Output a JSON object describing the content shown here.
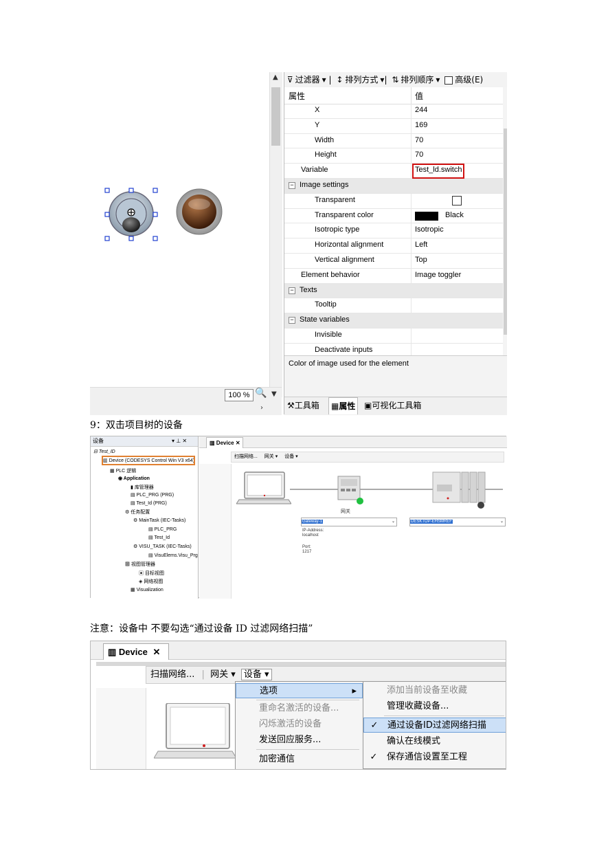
{
  "shot1": {
    "zoom": "100 %",
    "toolbar": {
      "filter": "过滤器",
      "sort_by": "排列方式",
      "sort_order": "排列顺序",
      "advanced": "高级(E)"
    },
    "header": {
      "property": "属性",
      "value": "值"
    },
    "rows": [
      {
        "key": "X",
        "value": "244"
      },
      {
        "key": "Y",
        "value": "169"
      },
      {
        "key": "Width",
        "value": "70"
      },
      {
        "key": "Height",
        "value": "70"
      },
      {
        "key": "Variable",
        "value": "Test_ld.switch"
      },
      {
        "key": "Image settings",
        "value": ""
      },
      {
        "key": "Transparent",
        "value": ""
      },
      {
        "key": "Transparent color",
        "value": "Black"
      },
      {
        "key": "Isotropic type",
        "value": "Isotropic"
      },
      {
        "key": "Horizontal alignment",
        "value": "Left"
      },
      {
        "key": "Vertical alignment",
        "value": "Top"
      },
      {
        "key": "Element behavior",
        "value": "Image toggler"
      },
      {
        "key": "Texts",
        "value": ""
      },
      {
        "key": "Tooltip",
        "value": ""
      },
      {
        "key": "State variables",
        "value": ""
      },
      {
        "key": "Invisible",
        "value": ""
      },
      {
        "key": "Deactivate inputs",
        "value": ""
      }
    ],
    "description": "Color of image used for the element",
    "tabs": {
      "toolbox": "工具箱",
      "properties": "属性",
      "visu_toolbox": "可视化工具箱"
    },
    "colors": {
      "highlight": "#d01010"
    }
  },
  "caption9": "9：双击项目树的设备",
  "shot2": {
    "tree_title": "设备",
    "tree": [
      "Test_ID",
      "Device (CODESYS Control Win V3 x64)",
      "PLC 逻辑",
      "Application",
      "库管理器",
      "PLC_PRG (PRG)",
      "Test_Id (PRG)",
      "任务配置",
      "MainTask (IEC-Tasks)",
      "PLC_PRG",
      "Test_Id",
      "VISU_TASK (IEC-Tasks)",
      "VisuElems.Visu_Prg",
      "视图管理器",
      "目标视图",
      "网络视图",
      "Visualization"
    ],
    "tab": "Device",
    "toolbar": {
      "scan": "扫描网络...",
      "gateway": "网关 ▾",
      "device": "设备 ▾"
    },
    "gateway_label": "网关",
    "gateway_select": "Gateway-1",
    "device_select": "DESKTOP-EHSMREF",
    "info": {
      "ip_label": "IP-Address:",
      "ip": "localhost",
      "port_label": "Port:",
      "port": "1217"
    },
    "colors": {
      "device_highlight": "#e08030",
      "online": "#20c040",
      "offline": "#404040"
    }
  },
  "note": "注意：设备中  不要勾选“通过设备 ID 过滤网络扫描”",
  "shot3": {
    "tab": "Device",
    "toolbar": {
      "scan": "扫描网络...",
      "gateway": "网关",
      "device": "设备"
    },
    "menu1": [
      {
        "label": "选项",
        "state": "selected",
        "submenu": true
      },
      {
        "label": "重命名激活的设备...",
        "state": "disabled"
      },
      {
        "label": "闪烁激活的设备",
        "state": "disabled"
      },
      {
        "label": "发送回应服务...",
        "state": "normal"
      },
      {
        "label": "加密通信",
        "state": "normal"
      }
    ],
    "menu2": [
      {
        "label": "添加当前设备至收藏",
        "state": "disabled",
        "checked": false
      },
      {
        "label": "管理收藏设备...",
        "state": "normal",
        "checked": false
      },
      {
        "label": "通过设备ID过滤网络扫描",
        "state": "selected",
        "checked": true
      },
      {
        "label": "确认在线模式",
        "state": "normal",
        "checked": false
      },
      {
        "label": "保存通信设置至工程",
        "state": "normal",
        "checked": true
      }
    ]
  }
}
